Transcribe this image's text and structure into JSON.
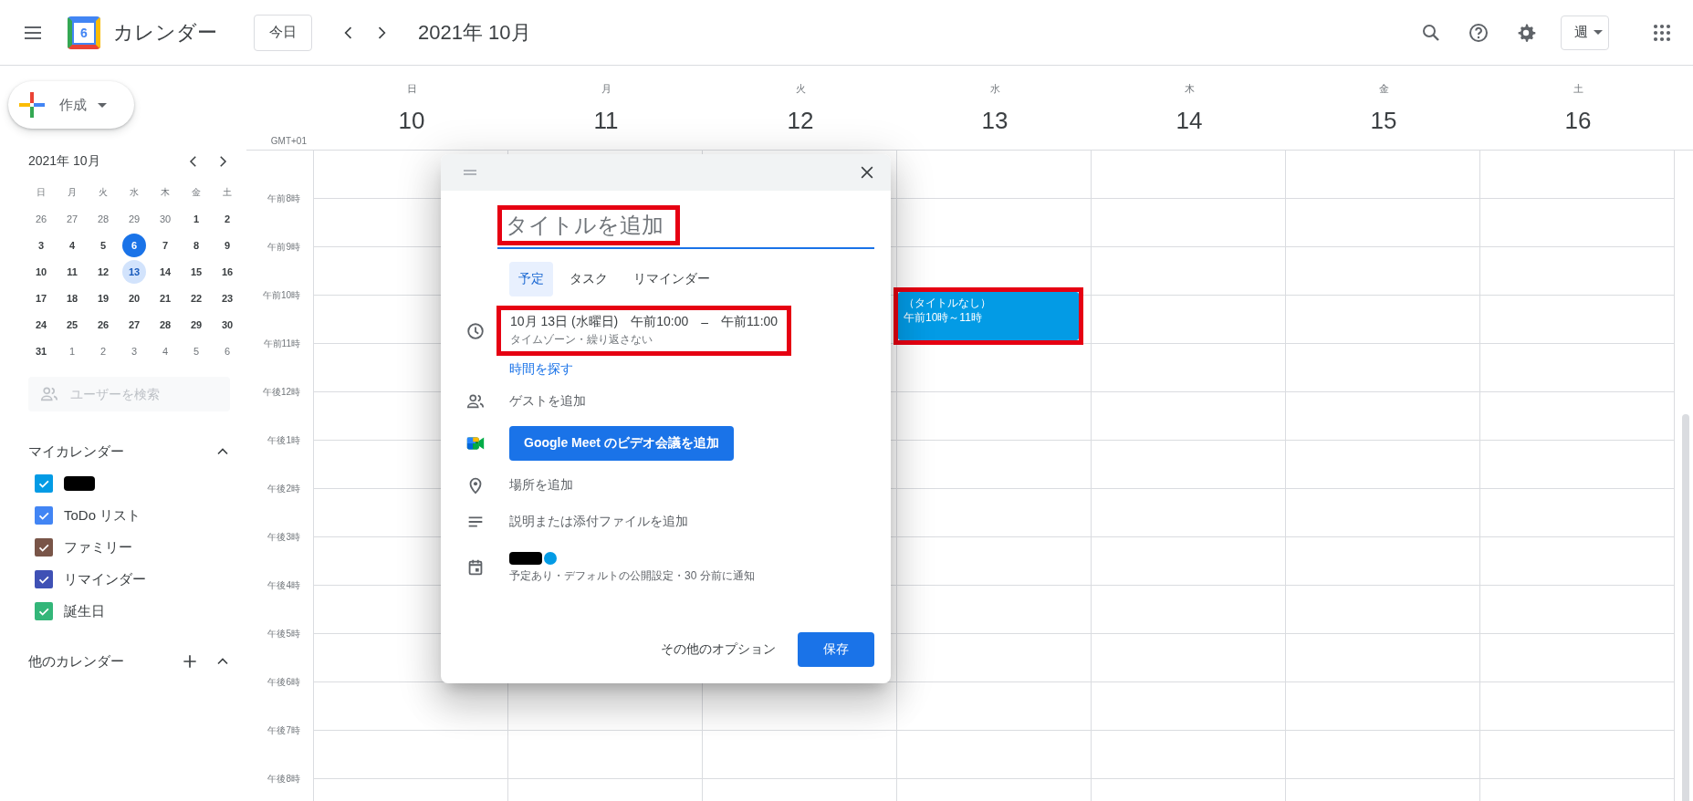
{
  "header": {
    "app_title": "カレンダー",
    "logo_day": "6",
    "today_button": "今日",
    "period": "2021年 10月",
    "view_button": "週"
  },
  "sidebar": {
    "create_button": "作成",
    "mini_calendar": {
      "title": "2021年 10月",
      "weekdays": [
        "日",
        "月",
        "火",
        "水",
        "木",
        "金",
        "土"
      ],
      "days": [
        {
          "day": "26",
          "muted": true,
          "today": false,
          "selected": false
        },
        {
          "day": "27",
          "muted": true,
          "today": false,
          "selected": false
        },
        {
          "day": "28",
          "muted": true,
          "today": false,
          "selected": false
        },
        {
          "day": "29",
          "muted": true,
          "today": false,
          "selected": false
        },
        {
          "day": "30",
          "muted": true,
          "today": false,
          "selected": false
        },
        {
          "day": "1",
          "muted": false,
          "today": false,
          "selected": false
        },
        {
          "day": "2",
          "muted": false,
          "today": false,
          "selected": false
        },
        {
          "day": "3",
          "muted": false,
          "today": false,
          "selected": false
        },
        {
          "day": "4",
          "muted": false,
          "today": false,
          "selected": false
        },
        {
          "day": "5",
          "muted": false,
          "today": false,
          "selected": false
        },
        {
          "day": "6",
          "muted": false,
          "today": true,
          "selected": false
        },
        {
          "day": "7",
          "muted": false,
          "today": false,
          "selected": false
        },
        {
          "day": "8",
          "muted": false,
          "today": false,
          "selected": false
        },
        {
          "day": "9",
          "muted": false,
          "today": false,
          "selected": false
        },
        {
          "day": "10",
          "muted": false,
          "today": false,
          "selected": false
        },
        {
          "day": "11",
          "muted": false,
          "today": false,
          "selected": false
        },
        {
          "day": "12",
          "muted": false,
          "today": false,
          "selected": false
        },
        {
          "day": "13",
          "muted": false,
          "today": false,
          "selected": true
        },
        {
          "day": "14",
          "muted": false,
          "today": false,
          "selected": false
        },
        {
          "day": "15",
          "muted": false,
          "today": false,
          "selected": false
        },
        {
          "day": "16",
          "muted": false,
          "today": false,
          "selected": false
        },
        {
          "day": "17",
          "muted": false,
          "today": false,
          "selected": false
        },
        {
          "day": "18",
          "muted": false,
          "today": false,
          "selected": false
        },
        {
          "day": "19",
          "muted": false,
          "today": false,
          "selected": false
        },
        {
          "day": "20",
          "muted": false,
          "today": false,
          "selected": false
        },
        {
          "day": "21",
          "muted": false,
          "today": false,
          "selected": false
        },
        {
          "day": "22",
          "muted": false,
          "today": false,
          "selected": false
        },
        {
          "day": "23",
          "muted": false,
          "today": false,
          "selected": false
        },
        {
          "day": "24",
          "muted": false,
          "today": false,
          "selected": false
        },
        {
          "day": "25",
          "muted": false,
          "today": false,
          "selected": false
        },
        {
          "day": "26",
          "muted": false,
          "today": false,
          "selected": false
        },
        {
          "day": "27",
          "muted": false,
          "today": false,
          "selected": false
        },
        {
          "day": "28",
          "muted": false,
          "today": false,
          "selected": false
        },
        {
          "day": "29",
          "muted": false,
          "today": false,
          "selected": false
        },
        {
          "day": "30",
          "muted": false,
          "today": false,
          "selected": false
        },
        {
          "day": "31",
          "muted": false,
          "today": false,
          "selected": false
        },
        {
          "day": "1",
          "muted": true,
          "today": false,
          "selected": false
        },
        {
          "day": "2",
          "muted": true,
          "today": false,
          "selected": false
        },
        {
          "day": "3",
          "muted": true,
          "today": false,
          "selected": false
        },
        {
          "day": "4",
          "muted": true,
          "today": false,
          "selected": false
        },
        {
          "day": "5",
          "muted": true,
          "today": false,
          "selected": false
        },
        {
          "day": "6",
          "muted": true,
          "today": false,
          "selected": false
        }
      ]
    },
    "user_search": {
      "placeholder": "ユーザーを検索"
    },
    "my_calendars": {
      "title": "マイカレンダー",
      "expanded": true,
      "items": [
        {
          "redacted": true,
          "checked": true,
          "color": "#039be5"
        },
        {
          "label": "ToDo リスト",
          "redacted": false,
          "checked": true,
          "color": "#4285f4"
        },
        {
          "label": "ファミリー",
          "redacted": false,
          "checked": true,
          "color": "#795548"
        },
        {
          "label": "リマインダー",
          "redacted": false,
          "checked": true,
          "color": "#3f51b5"
        },
        {
          "label": "誕生日",
          "redacted": false,
          "checked": true,
          "color": "#33b679"
        }
      ]
    },
    "other_calendars": {
      "title": "他のカレンダー",
      "expanded": true
    }
  },
  "week": {
    "timezone": "GMT+01",
    "days": [
      {
        "weekday": "日",
        "date": "10"
      },
      {
        "weekday": "月",
        "date": "11"
      },
      {
        "weekday": "火",
        "date": "12"
      },
      {
        "weekday": "水",
        "date": "13",
        "events": [
          {
            "title": "（タイトルなし）",
            "time": "午前10時～11時",
            "highlighted": true
          }
        ]
      },
      {
        "weekday": "木",
        "date": "14"
      },
      {
        "weekday": "金",
        "date": "15"
      },
      {
        "weekday": "土",
        "date": "16"
      }
    ],
    "hours": [
      "午前8時",
      "午前9時",
      "午前10時",
      "午前11時",
      "午後12時",
      "午後1時",
      "午後2時",
      "午後3時",
      "午後4時",
      "午後5時",
      "午後6時",
      "午後7時",
      "午後8時"
    ]
  },
  "dialog": {
    "title_placeholder": "タイトルを追加",
    "title_highlighted": true,
    "tabs": [
      {
        "label": "予定",
        "selected": true
      },
      {
        "label": "タスク",
        "selected": false
      },
      {
        "label": "リマインダー",
        "selected": false
      }
    ],
    "datetime": {
      "highlighted": true,
      "date": "10月 13日 (水曜日)",
      "start": "午前10:00",
      "separator": "–",
      "end": "午前11:00",
      "details": "タイムゾーン・繰り返さない"
    },
    "find_time_link": "時間を探す",
    "rows": [
      {
        "kind": "text",
        "text": "ゲストを追加"
      },
      {
        "kind": "button",
        "text": "Google Meet のビデオ会議を追加"
      },
      {
        "kind": "text",
        "text": "場所を追加"
      },
      {
        "kind": "text",
        "text": "説明または添付ファイルを追加"
      }
    ],
    "calendar": {
      "redacted": true,
      "details": "予定あり・デフォルトの公開設定・30 分前に通知"
    },
    "more_options_button": "その他のオプション",
    "save_button": "保存"
  }
}
